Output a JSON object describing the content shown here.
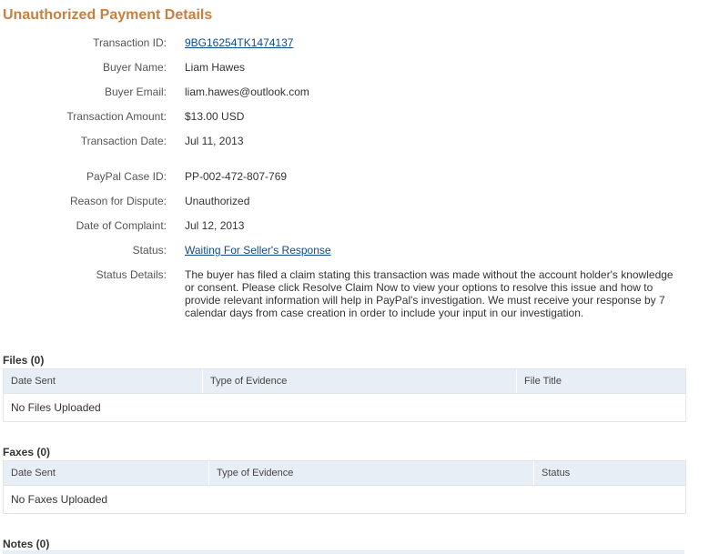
{
  "page": {
    "title": "Unauthorized Payment Details"
  },
  "transaction": {
    "id_label": "Transaction ID:",
    "id_value": "9BG16254TK1474137",
    "buyer_name_label": "Buyer Name:",
    "buyer_name_value": "Liam Hawes",
    "buyer_email_label": "Buyer Email:",
    "buyer_email_value": "liam.hawes@outlook.com",
    "amount_label": "Transaction Amount:",
    "amount_value": "$13.00 USD",
    "date_label": "Transaction Date:",
    "date_value": "Jul 11, 2013"
  },
  "case": {
    "case_id_label": "PayPal Case ID:",
    "case_id_value": "PP-002-472-807-769",
    "reason_label": "Reason for Dispute:",
    "reason_value": "Unauthorized",
    "complaint_date_label": "Date of Complaint:",
    "complaint_date_value": "Jul 12, 2013",
    "status_label": "Status:",
    "status_value": "Waiting For Seller's Response",
    "status_details_label": "Status Details:",
    "status_details_value": "The buyer has filed a claim stating this transaction was made without the account holder's knowledge or consent. Please click Resolve Claim Now to view your options to resolve this issue and how to provide relevant information will help in PayPal's investigation. We must receive your response by 7 calendar days from case creation in order to include your input in our investigation."
  },
  "files": {
    "title": "Files (0)",
    "columns": [
      "Date Sent",
      "Type of Evidence",
      "File Title"
    ],
    "empty_text": "No Files Uploaded"
  },
  "faxes": {
    "title": "Faxes (0)",
    "columns": [
      "Date Sent",
      "Type of Evidence",
      "Status"
    ],
    "empty_text": "No Faxes Uploaded"
  },
  "notes": {
    "title": "Notes (0)"
  },
  "colors": {
    "title": "#c8803f",
    "link": "#114a8b",
    "table_header": "#e8eef5"
  }
}
